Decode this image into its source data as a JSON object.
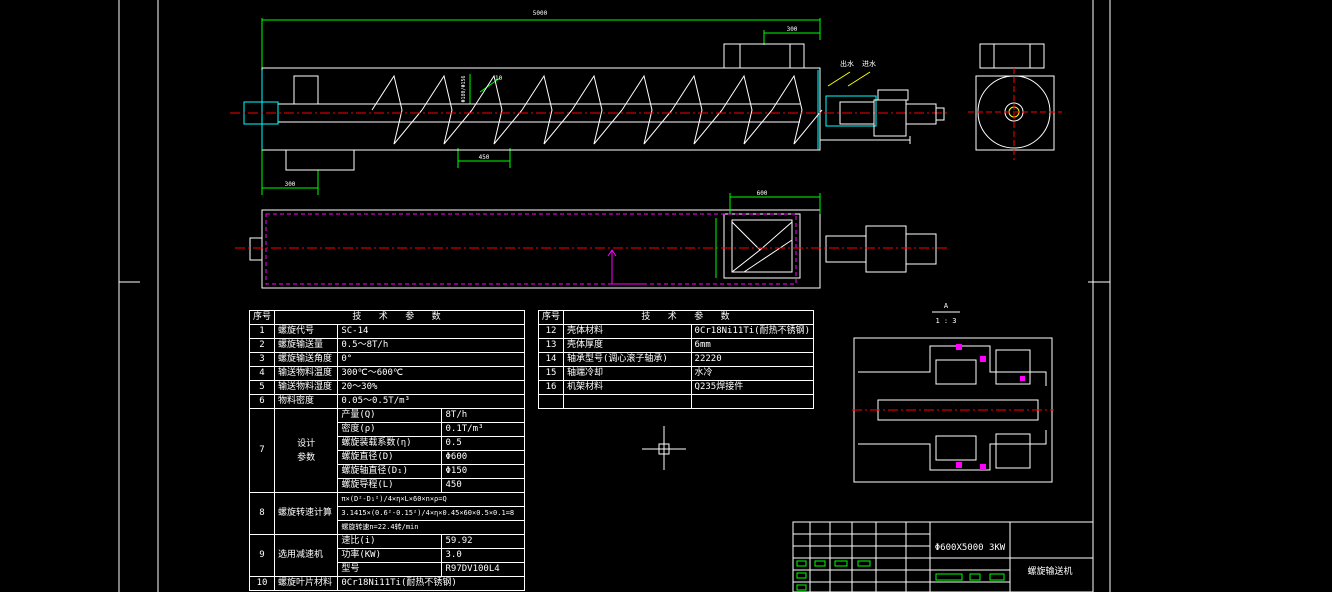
{
  "dims": {
    "overall_length": "5000",
    "inlet_width": "300",
    "outlet_width": "300",
    "pitch": "450",
    "diameter": "Φ600",
    "plan_width": "600",
    "angle": "10",
    "tube_dia": "Φ180/Φ156"
  },
  "callouts": {
    "c1": "出水",
    "c2": "进水"
  },
  "section_mark": {
    "letter": "A",
    "scale": "1 : 3"
  },
  "left_table": {
    "col_no": "序号",
    "header": "技 术 参 数",
    "rows": [
      {
        "no": "1",
        "name": "螺旋代号",
        "value": "SC-14"
      },
      {
        "no": "2",
        "name": "螺旋输送量",
        "value": "0.5～8T/h"
      },
      {
        "no": "3",
        "name": "螺旋输送角度",
        "value": "0°"
      },
      {
        "no": "4",
        "name": "输送物料温度",
        "value": "300℃～600℃"
      },
      {
        "no": "5",
        "name": "输送物料湿度",
        "value": "20～30%"
      },
      {
        "no": "6",
        "name": "物料密度",
        "value": "0.05～0.5T/m³"
      }
    ],
    "row7": {
      "no": "7",
      "name_a": "设计",
      "name_b": "参数",
      "items": [
        {
          "k": "产量(Q)",
          "v": "8T/h"
        },
        {
          "k": "密度(ρ)",
          "v": "0.1T/m³"
        },
        {
          "k": "螺旋装载系数(η)",
          "v": "0.5"
        },
        {
          "k": "螺旋直径(D)",
          "v": "Φ600"
        },
        {
          "k": "螺旋轴直径(D₁)",
          "v": "Φ150"
        },
        {
          "k": "螺旋导程(L)",
          "v": "450"
        }
      ]
    },
    "row8": {
      "no": "8",
      "name": "螺旋转速计算",
      "lines": [
        "π×(D²-D₁²)/4×η×L×60×n×ρ=Q",
        "3.1415×(0.6²-0.15²)/4×η×0.45×60×0.5×0.1=8",
        "螺旋转速n=22.4转/min"
      ]
    },
    "row9": {
      "no": "9",
      "name": "选用减速机",
      "items": [
        {
          "k": "速比(i)",
          "v": "59.92"
        },
        {
          "k": "功率(KW)",
          "v": "3.0"
        },
        {
          "k": "型号",
          "v": "R97DV100L4"
        }
      ]
    },
    "row10": {
      "no": "10",
      "name": "螺旋叶片材料",
      "value": "0Cr18Ni11Ti(耐热不锈钢)"
    }
  },
  "right_table": {
    "col_no": "序号",
    "header": "技 术 参 数",
    "rows": [
      {
        "no": "12",
        "name": "壳体材料",
        "value": "0Cr18Ni11Ti(耐热不锈钢)"
      },
      {
        "no": "13",
        "name": "壳体厚度",
        "value": "6mm"
      },
      {
        "no": "14",
        "name": "轴承型号(调心滚子轴承)",
        "value": "22220"
      },
      {
        "no": "15",
        "name": "轴端冷却",
        "value": "水冷"
      },
      {
        "no": "16",
        "name": "机架材料",
        "value": "Q235焊接件"
      }
    ]
  },
  "title_block": {
    "model": "Φ600X5000  3KW",
    "title": "螺旋输送机"
  },
  "colors": {
    "bg": "#000000",
    "line": "#ffffff",
    "dim": "#00ff00",
    "center": "#ff0000",
    "hidden": "#ff00ff",
    "cyan": "#00ffff",
    "yellow": "#ffff00"
  }
}
